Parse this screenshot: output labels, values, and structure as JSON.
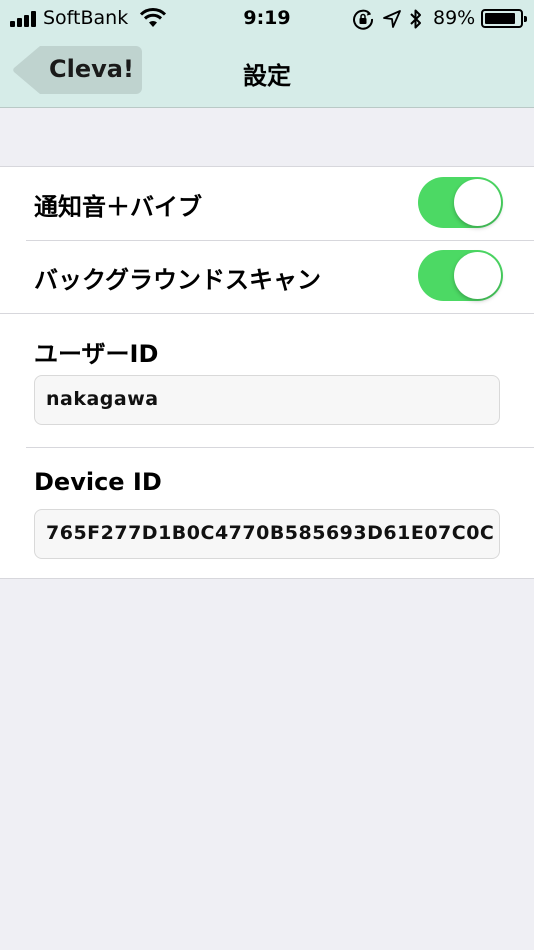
{
  "status_bar": {
    "carrier": "SoftBank",
    "time": "9:19",
    "battery_percent": "89%",
    "battery_level": 0.89,
    "icons": [
      "signal-icon",
      "wifi-icon",
      "rotation-lock-icon",
      "location-icon",
      "bluetooth-icon",
      "battery-icon"
    ]
  },
  "nav": {
    "back_label": "Cleva!",
    "title": "設定"
  },
  "settings": {
    "notification": {
      "label": "通知音＋バイブ",
      "on": true
    },
    "background_scan": {
      "label": "バックグラウンドスキャン",
      "on": true
    },
    "user_id": {
      "label": "ユーザーID",
      "value": "nakagawa"
    },
    "device_id": {
      "label": "Device ID",
      "value": "765F277D1B0C4770B585693D61E07C0C"
    }
  },
  "colors": {
    "nav_background": "#d6ece8",
    "toggle_on": "#4cd964",
    "page_background": "#efeff4"
  }
}
